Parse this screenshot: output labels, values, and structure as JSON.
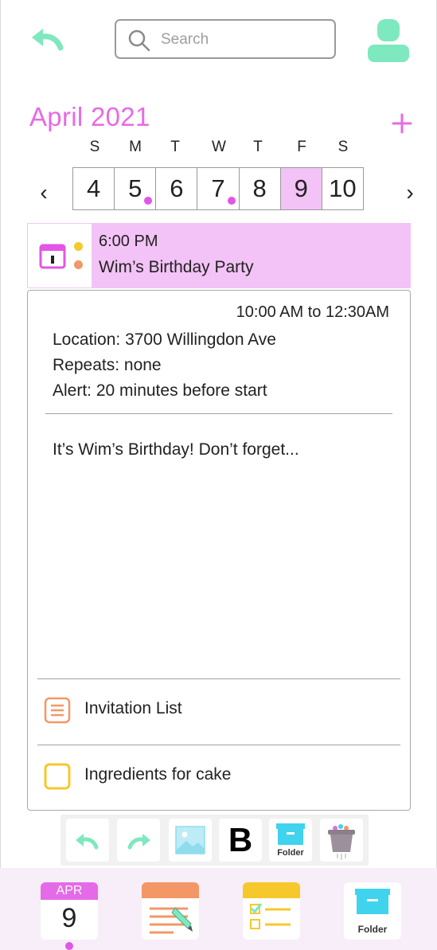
{
  "header": {
    "search_placeholder": "Search"
  },
  "calendar": {
    "month_label": "April 2021",
    "weekdays": [
      "S",
      "M",
      "T",
      "W",
      "T",
      "F",
      "S"
    ],
    "days": [
      "4",
      "5",
      "6",
      "7",
      "8",
      "9",
      "10"
    ],
    "selected_day": "9",
    "days_with_events": [
      "5",
      "7"
    ],
    "prev_label": "‹",
    "next_label": "›"
  },
  "event": {
    "time": "6:00 PM",
    "title": "Wim’s Birthday Party",
    "time_range": "10:00 AM to 12:30AM",
    "location": "Location: 3700 Willingdon Ave",
    "repeats": "Repeats: none",
    "alert": "Alert: 20 minutes before start",
    "note": "It’s Wim’s Birthday! Don’t forget...",
    "attachments": [
      {
        "label": "Invitation List",
        "icon": "list-icon"
      },
      {
        "label": "Ingredients for cake",
        "icon": "checkbox-icon"
      }
    ]
  },
  "toolbar": {
    "bold_label": "B",
    "folder_label": "Folder"
  },
  "bottom_nav": {
    "calendar_month": "APR",
    "calendar_day": "9",
    "folder_label": "Folder"
  },
  "colors": {
    "accent_pink": "#e66ae6",
    "selected_day_bg": "#f3c2f6",
    "mint": "#7ee8bf",
    "folder_cyan": "#3fd3ee",
    "orange": "#f39766",
    "yellow": "#f7c82b"
  }
}
